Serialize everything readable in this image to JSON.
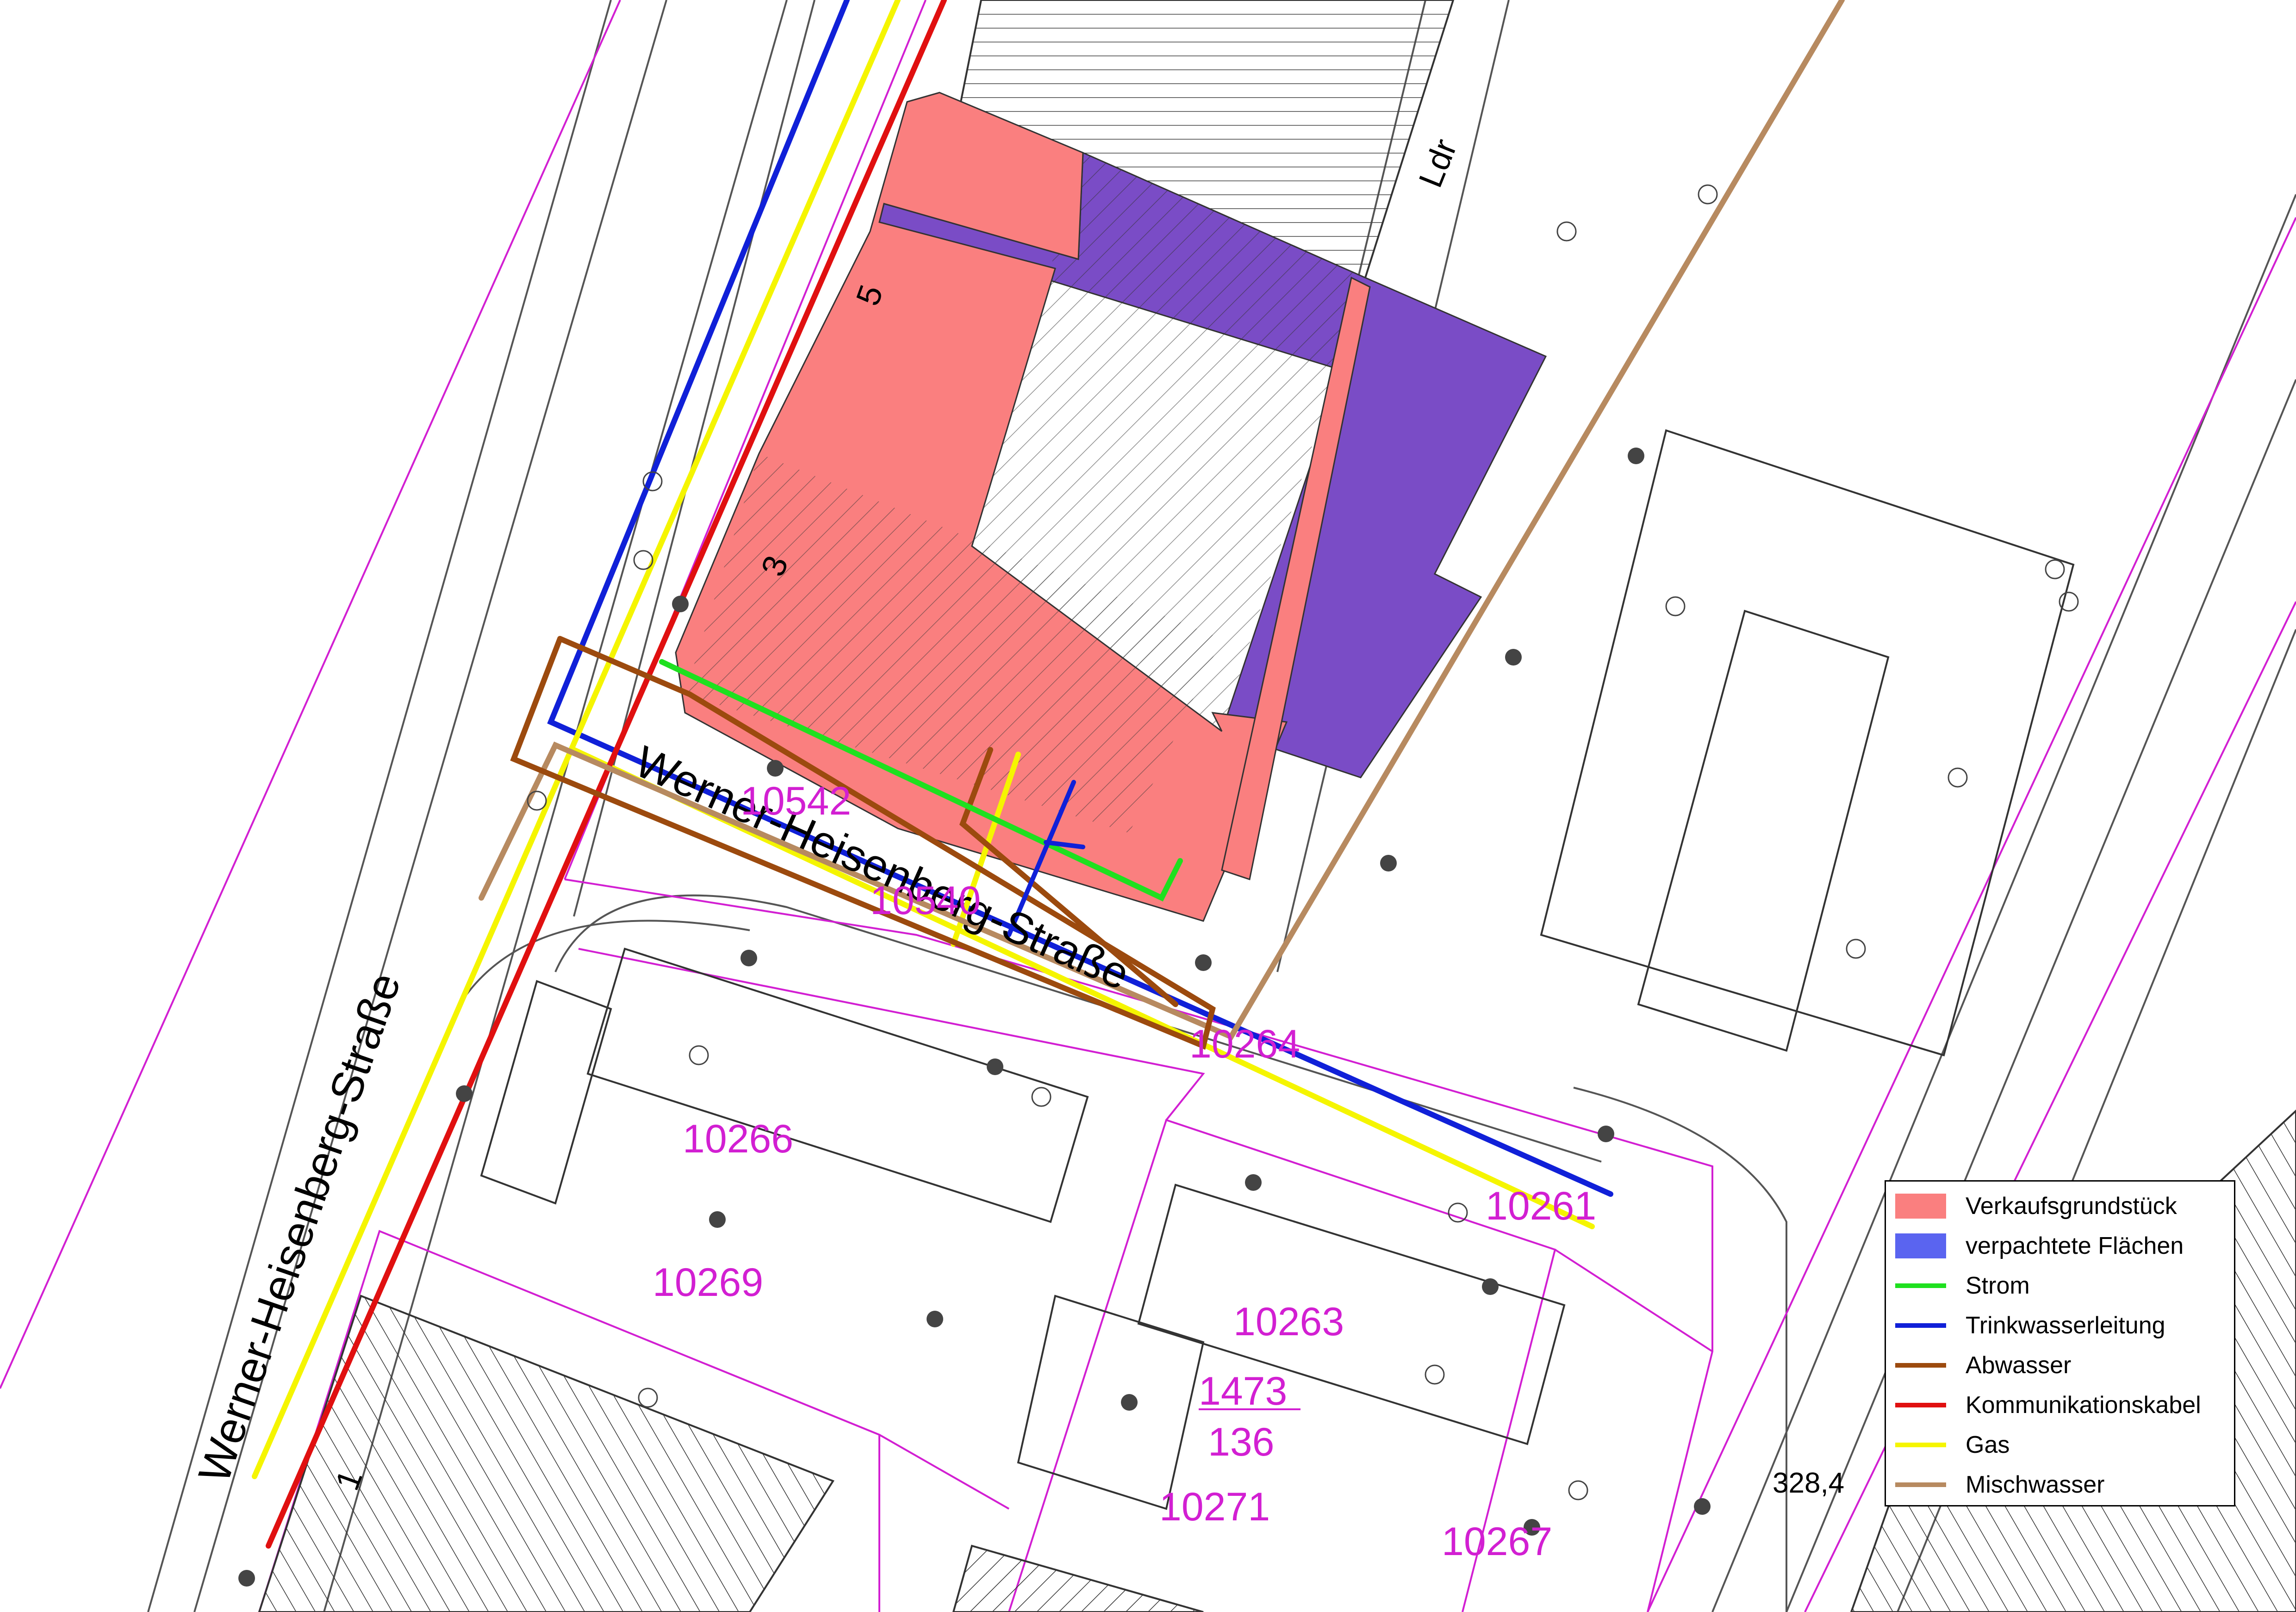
{
  "streets": {
    "main_label": "Werner-Heisenberg-Straße",
    "cross_label": "Werner-Heisenberg-Straße",
    "ldr_label": "Ldr"
  },
  "house_numbers": {
    "n5": "5",
    "n3": "3",
    "n1": "1"
  },
  "parcels": {
    "p10542": "10542",
    "p10540": "10540",
    "p10264": "10264",
    "p10266": "10266",
    "p10261": "10261",
    "p10269": "10269",
    "p10263": "10263",
    "p1473": "1473",
    "p136": "136",
    "p10271": "10271",
    "p10267": "10267"
  },
  "elevation": "328,4",
  "colors": {
    "sale": "#fa7f7f",
    "leased": "#7a4cc6",
    "power": "#1fe01f",
    "water": "#1020d8",
    "sewage": "#9c4a0e",
    "comms": "#e01010",
    "gas": "#f5f500",
    "mixed": "#b78a60",
    "parcel_boundary": "#d21fd2"
  },
  "legend": {
    "items": [
      {
        "label": "Verkaufsgrundstück",
        "kind": "fill",
        "color": "#fa7f7f"
      },
      {
        "label": "verpachtete Flächen",
        "kind": "fill",
        "color": "#5a64f0"
      },
      {
        "label": "Strom",
        "kind": "line",
        "color": "#1fe01f"
      },
      {
        "label": "Trinkwasserleitung",
        "kind": "line",
        "color": "#1020d8"
      },
      {
        "label": "Abwasser",
        "kind": "line",
        "color": "#9c4a0e"
      },
      {
        "label": "Kommunikationskabel",
        "kind": "line",
        "color": "#e01010"
      },
      {
        "label": "Gas",
        "kind": "line",
        "color": "#f5f500"
      },
      {
        "label": "Mischwasser",
        "kind": "line",
        "color": "#b78a60"
      }
    ]
  }
}
